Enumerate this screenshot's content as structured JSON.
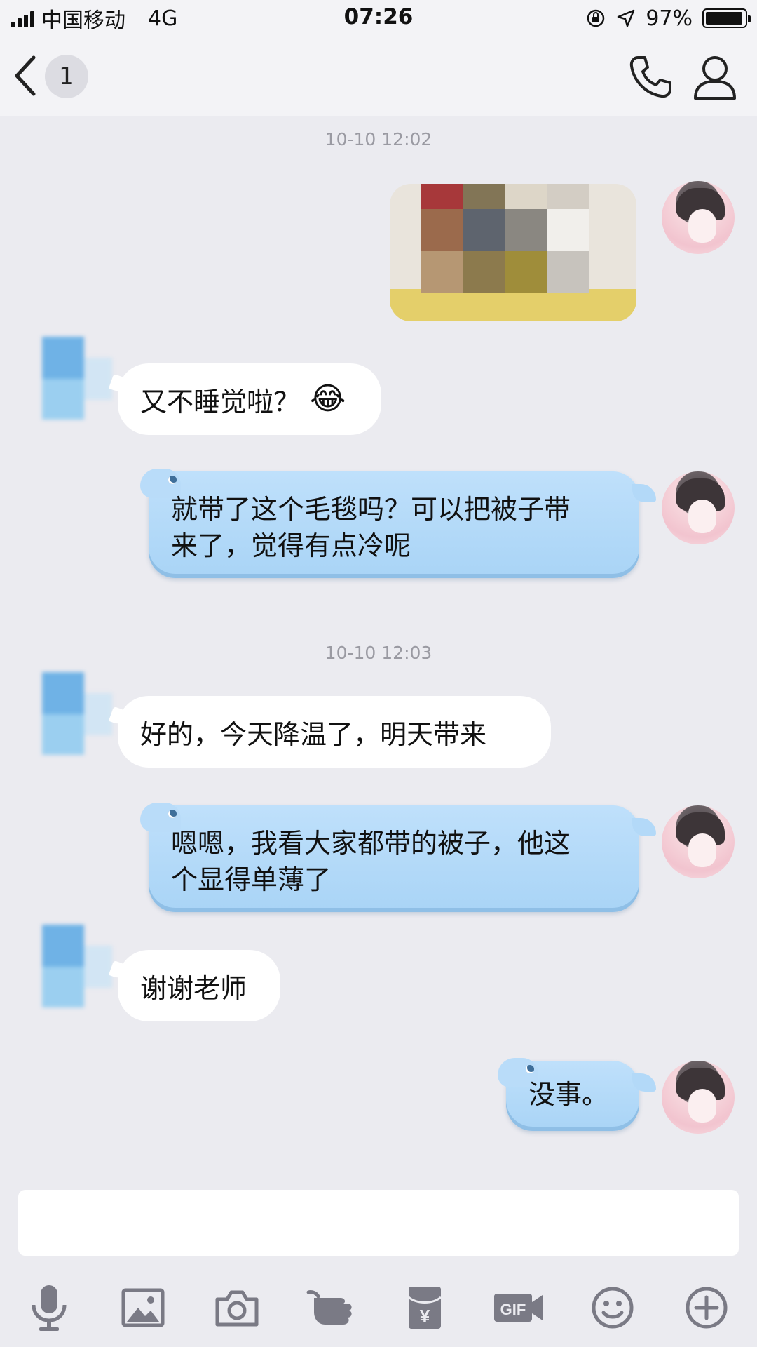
{
  "status_bar": {
    "carrier": "中国移动",
    "network": "4G",
    "time": "07:26",
    "battery_percent": "97%",
    "battery_level": 0.97
  },
  "nav": {
    "unread_count": "1",
    "back_icon": "chevron-left-icon",
    "phone_icon": "phone-icon",
    "profile_icon": "person-icon"
  },
  "chat": {
    "timestamps": [
      "10-10 12:02",
      "10-10 12:03"
    ],
    "messages": [
      {
        "side": "right",
        "type": "image"
      },
      {
        "side": "left",
        "text": "又不睡觉啦？"
      },
      {
        "side": "right",
        "line1": "就带了这个毛毯吗？可以把被子带",
        "line2": "来了，觉得有点冷呢"
      },
      {
        "side": "left",
        "text": "好的，今天降温了，明天带来"
      },
      {
        "side": "right",
        "line1": "嗯嗯，我看大家都带的被子，他这",
        "line2": "个显得单薄了"
      },
      {
        "side": "left",
        "text": "谢谢老师"
      },
      {
        "side": "right",
        "text": "没事。"
      }
    ]
  },
  "toolbar": {
    "icons": [
      "microphone-icon",
      "image-icon",
      "camera-icon",
      "poke-icon",
      "red-packet-icon",
      "gif-icon",
      "emoji-icon",
      "plus-icon"
    ],
    "red_packet_symbol": "¥",
    "gif_text": "GIF"
  },
  "colors": {
    "background": "#ebebf0",
    "bubble_right": "#a9d4f6",
    "bubble_left": "#ffffff",
    "icon_gray": "#7a7a85"
  }
}
